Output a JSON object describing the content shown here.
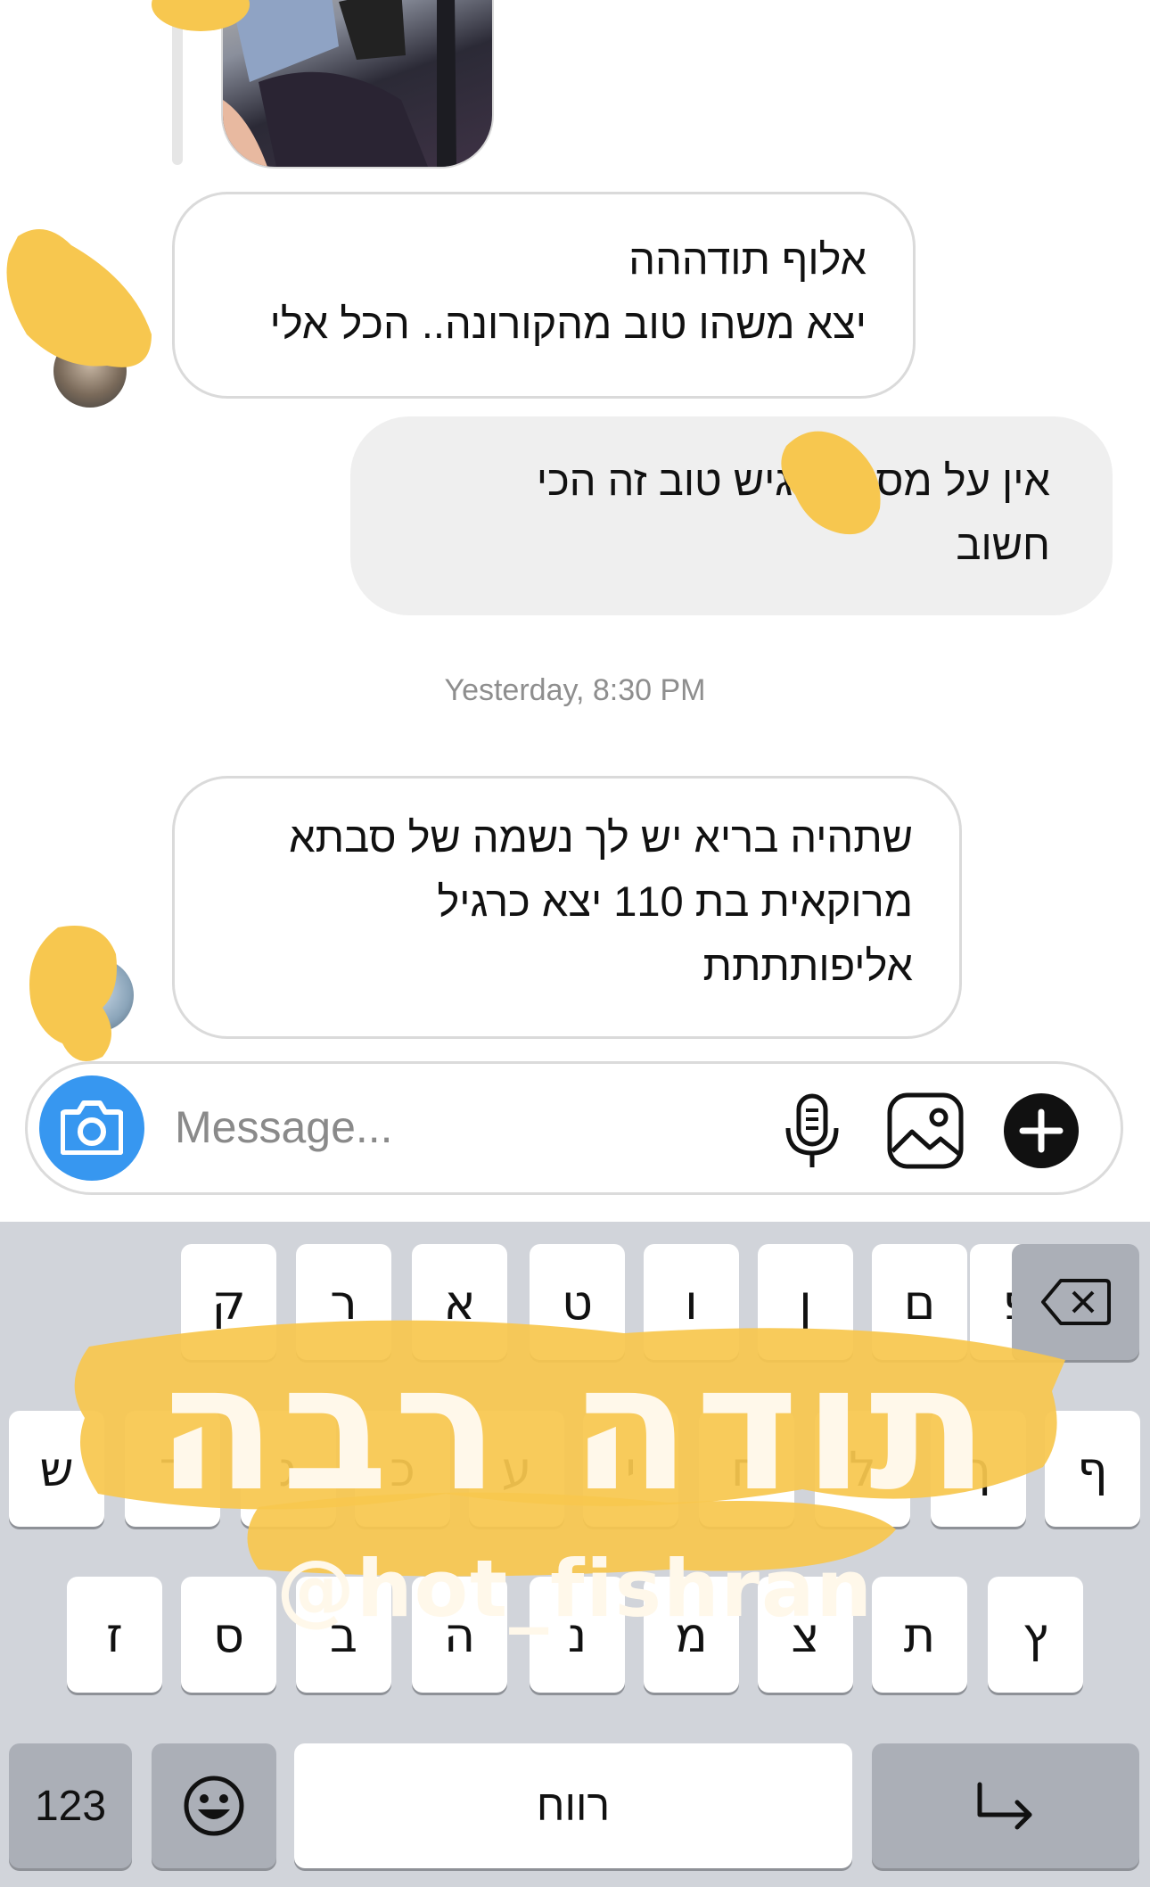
{
  "messages": [
    {
      "side": "in",
      "lines": [
        "אלוף תודההה",
        "יצא משהו טוב מהקורונה.. הכל אלי"
      ]
    },
    {
      "side": "out",
      "lines": [
        "אין על מסר תרגיש טוב זה הכי",
        "חשוב"
      ]
    },
    {
      "side": "in",
      "lines": [
        "שתהיה בריא יש לך נשמה של סבתא",
        "מרוקאית בת 110 יצא כרגיל",
        "אליפותתתת"
      ]
    }
  ],
  "timestamp": "Yesterday, 8:30 PM",
  "composer": {
    "placeholder": "Message...",
    "icons": [
      "camera-icon",
      "microphone-icon",
      "gallery-icon",
      "plus-icon"
    ]
  },
  "keyboard": {
    "row1": [
      "ק",
      "ר",
      "א",
      "ט",
      "ו",
      "ן",
      "ם",
      "פ"
    ],
    "row2": [
      "ש",
      "ד",
      "ג",
      "כ",
      "ע",
      "י",
      "ח",
      "ל",
      "ך",
      "ף"
    ],
    "row3": [
      "ז",
      "ס",
      "ב",
      "ה",
      "נ",
      "מ",
      "צ",
      "ת",
      "ץ"
    ],
    "numbers_key": "123",
    "space_key": "רווח",
    "icons": [
      "backspace-icon",
      "emoji-icon",
      "return-icon"
    ]
  },
  "sticker": {
    "title": "תודה רבה",
    "handle": "@hot_fishran",
    "color": "#f7c74f"
  },
  "colors": {
    "accent_blue": "#3797f0",
    "highlight_yellow": "#f7c74f",
    "outgoing_bubble": "#efefef"
  }
}
